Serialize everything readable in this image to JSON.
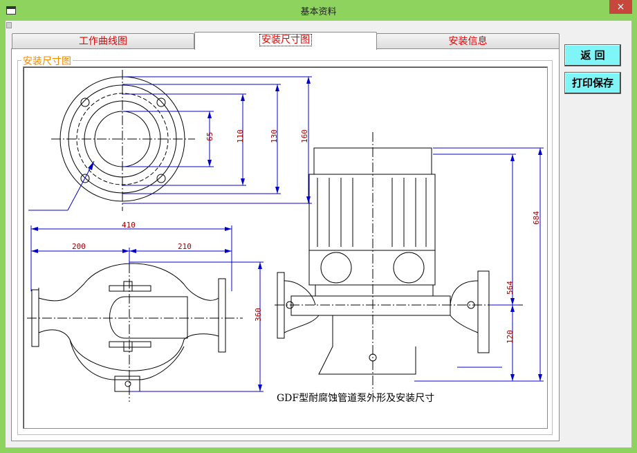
{
  "window": {
    "title": "基本资料",
    "close_glyph": "×"
  },
  "tabs": [
    {
      "label": "工作曲线图",
      "active": false
    },
    {
      "label": "安装尺寸图",
      "active": true
    },
    {
      "label": "安装信息",
      "active": false
    }
  ],
  "group": {
    "label": "安装尺寸图"
  },
  "buttons": {
    "back_label": "返  回",
    "print_save_label": "打印保存"
  },
  "drawing": {
    "caption": "GDF型耐腐蚀管道泵外形及安装尺寸",
    "flange_dims": [
      "65",
      "110",
      "130",
      "160"
    ],
    "front_dims": {
      "overall_width": "410",
      "left_width": "200",
      "right_width": "210",
      "height": "360"
    },
    "side_dims": {
      "overall_height": "684",
      "top_height": "564",
      "bottom_height": "120"
    }
  },
  "colors": {
    "accent": "#8fd35f",
    "button": "#7ff5f8",
    "tab_text": "#e00000",
    "group_label": "#f08a00",
    "dimension": "#0000cc"
  }
}
